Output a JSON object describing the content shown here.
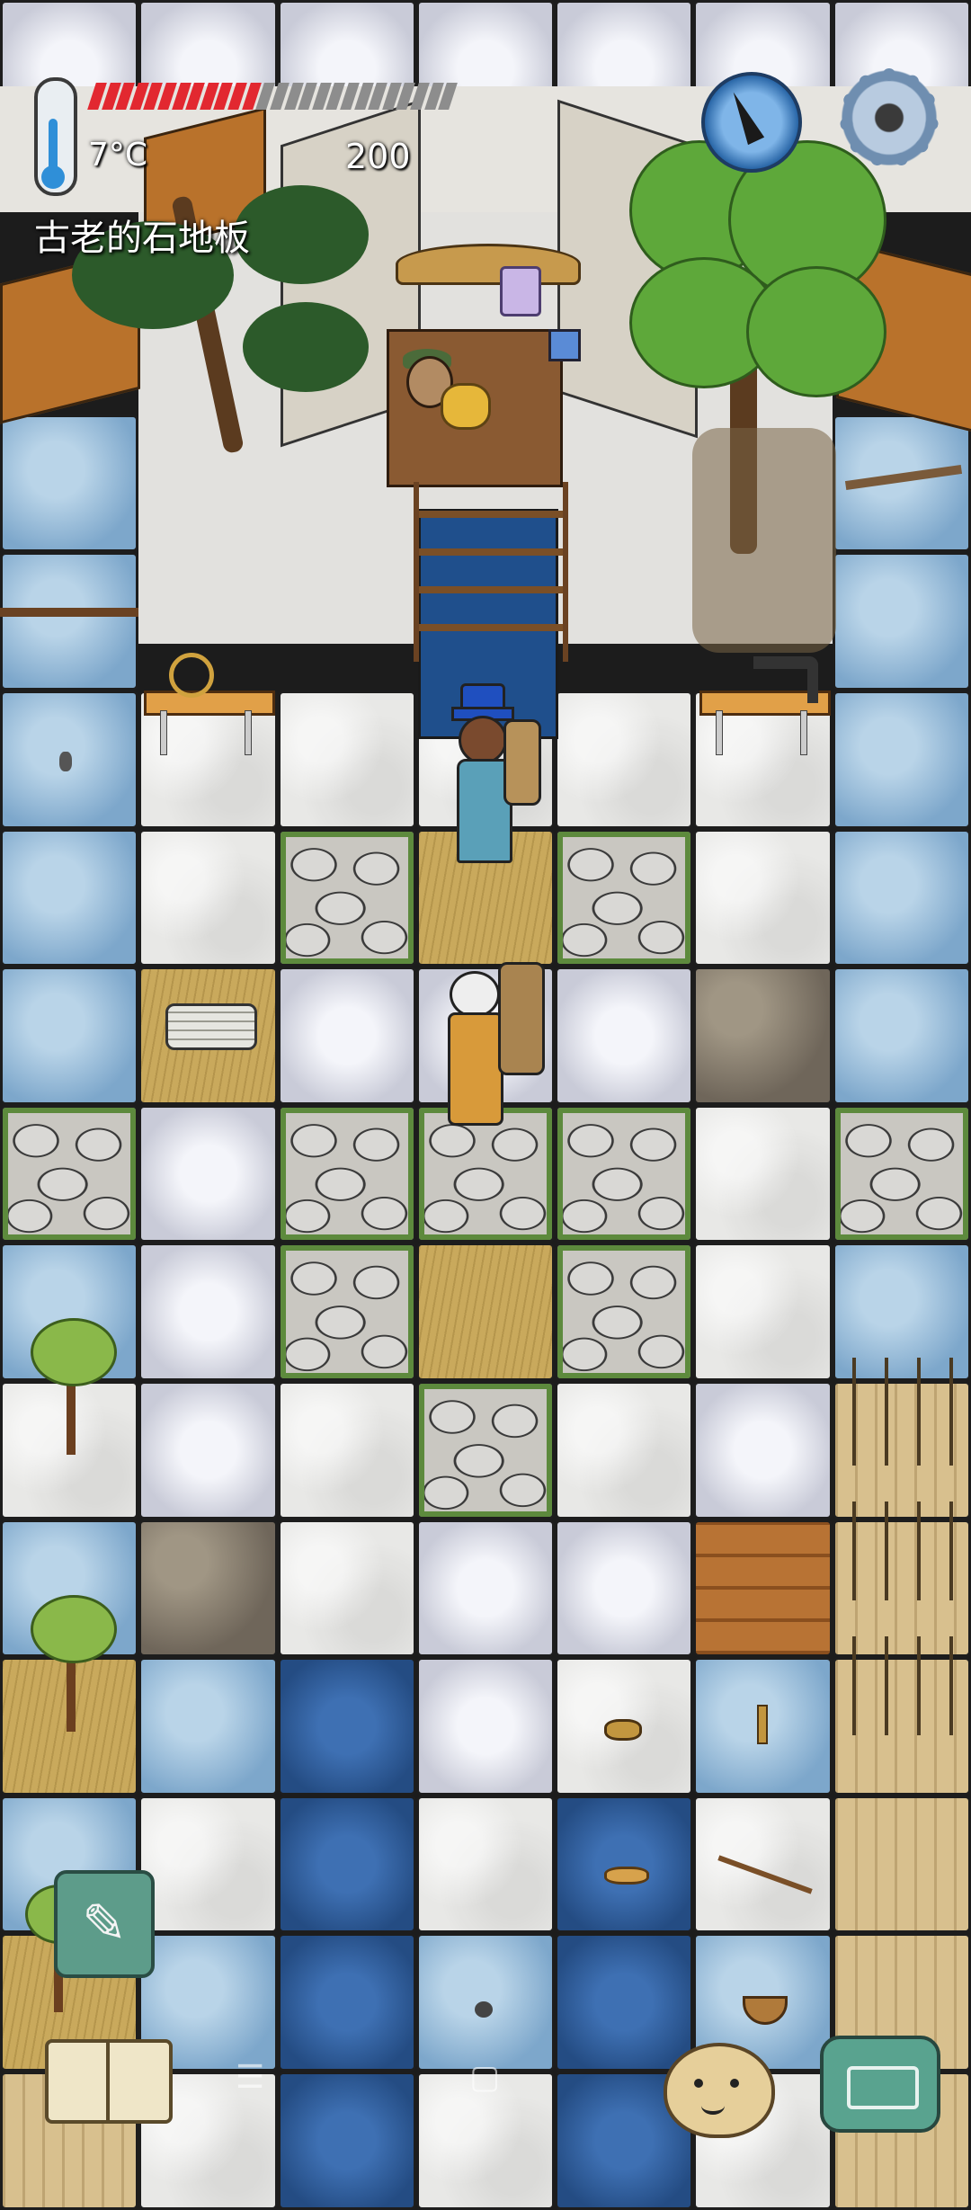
{
  "hud": {
    "temperature": "7°C",
    "food_value": "200",
    "food_fill_fraction": 0.45,
    "tile_name": "古老的石地板",
    "food_filled_color": "#e22830",
    "food_empty_color": "#8d8d8d"
  },
  "icons": {
    "thermometer": "thermometer-icon",
    "compass": "compass-icon",
    "settings": "gear-icon",
    "pencil": "pencil-icon",
    "book": "book-icon",
    "emote": "emote-face-icon",
    "keyboard": "keyboard-icon"
  },
  "board": {
    "rows": [
      "lllllll",
      "xxxxxxx",
      "xxxxxxx",
      "bxxxxxb",
      "bxxxxxb",
      "bwwwwwb",
      "bwcycwb",
      "bylllob",
      "clcccwc",
      "blcycwb",
      "wlwcwln",
      "bowllpn",
      "ybdlwbn",
      "bwdwdwn",
      "ybdbdbn",
      "nwdwdwn"
    ]
  },
  "colors": {
    "accent_teal": "#5d9c8a",
    "water_blue": "#2f5f9e",
    "light_blue_tile": "#8fb7d6"
  }
}
